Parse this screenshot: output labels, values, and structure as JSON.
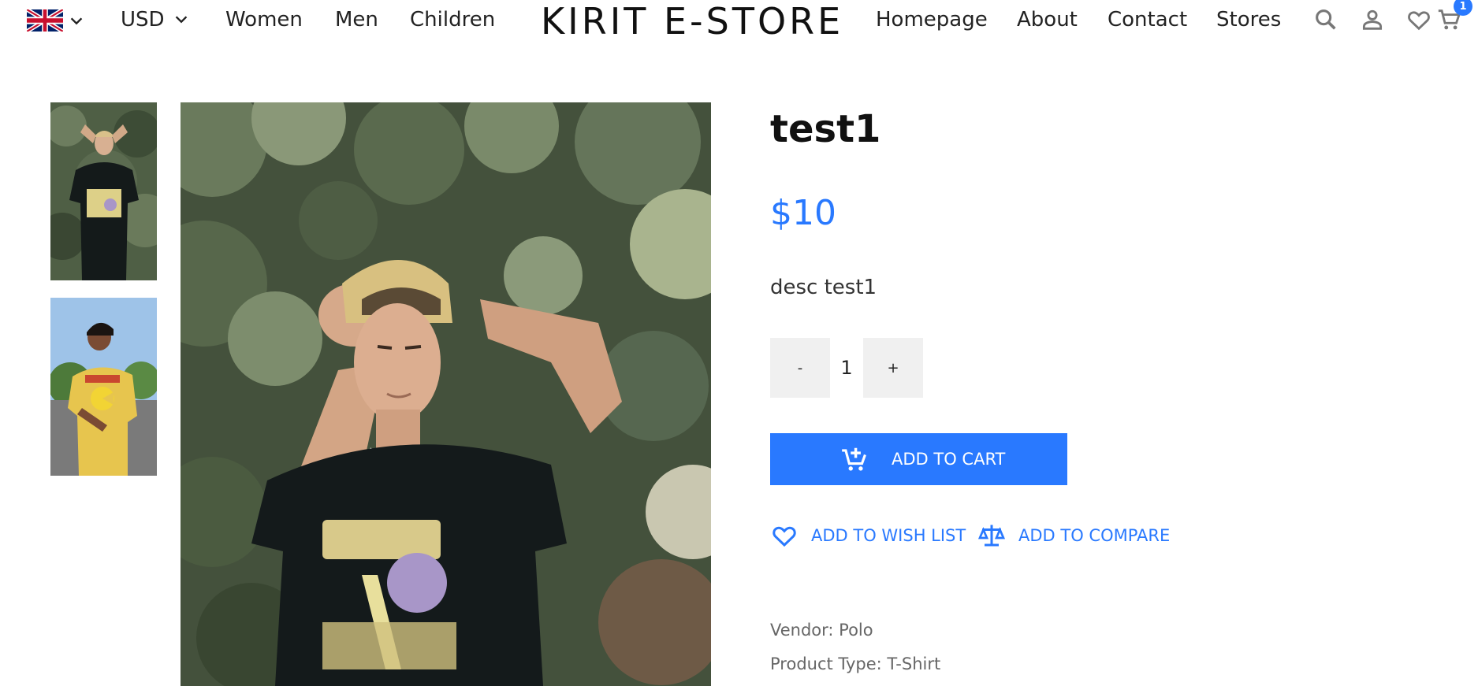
{
  "header": {
    "flag_icon": "uk-flag-icon",
    "currency": "USD",
    "nav_left": [
      "Women",
      "Men",
      "Children"
    ],
    "brand": "KIRIT E-STORE",
    "nav_right": [
      "Homepage",
      "About",
      "Contact",
      "Stores"
    ],
    "icons": [
      "search-icon",
      "user-icon",
      "heart-icon",
      "cart-icon"
    ],
    "cart_count": "1"
  },
  "product": {
    "title": "test1",
    "price": "$10",
    "description": "desc test1",
    "quantity": "1",
    "qty_minus_label": "-",
    "qty_plus_label": "+",
    "add_to_cart_label": "ADD TO CART",
    "wishlist_label": "ADD TO WISH LIST",
    "compare_label": "ADD TO COMPARE",
    "vendor": "Vendor: Polo",
    "product_type": "Product Type: T-Shirt"
  },
  "colors": {
    "accent": "#2979ff",
    "button_bg": "#f0f0f0",
    "text": "#222222",
    "meta_text": "#666666"
  }
}
